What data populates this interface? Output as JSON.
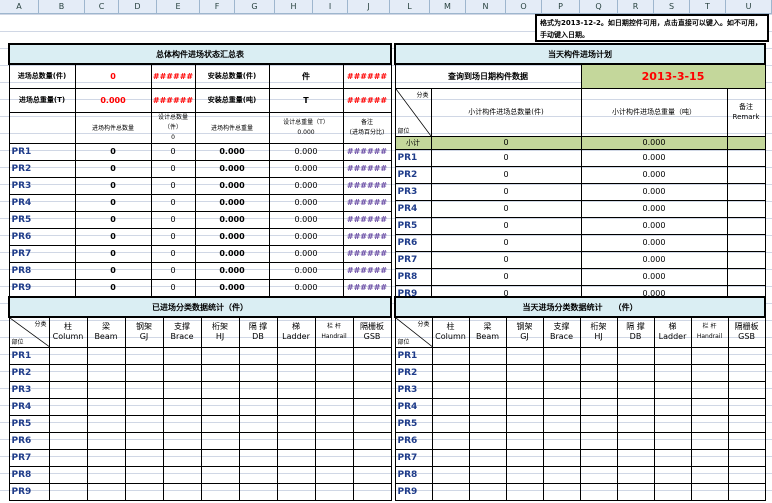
{
  "columns": [
    "A",
    "B",
    "C",
    "D",
    "E",
    "F",
    "G",
    "H",
    "I",
    "J",
    "L",
    "M",
    "N",
    "O",
    "P",
    "Q",
    "R",
    "S",
    "T",
    "U"
  ],
  "note": "格式为2013-12-2。如日期控件可用，点击直接可以键入。如不可用，手动键入日期。",
  "left_summary": {
    "title": "总体构件进场状态汇总表",
    "row1": {
      "label": "进场总数量(件)",
      "value": "0",
      "hash": "######",
      "label2": "安装总数量(件)",
      "unit": "件",
      "hash2": "######"
    },
    "row2": {
      "label": "进场总重量(T)",
      "value": "0.000",
      "hash": "######",
      "label2": "安装总重量(吨)",
      "unit": "T",
      "hash2": "######"
    },
    "header": {
      "col1": "进场构件总数量",
      "col2": "设计总数量（件）",
      "col2sub": "0",
      "col3": "进场构件总重量",
      "col4": "设计总重量（T）",
      "col4sub": "0.000",
      "col5": "备注",
      "col5sub": "(进场百分比)"
    },
    "rows": [
      {
        "name": "PR1",
        "count": "0",
        "design": "0",
        "weight": "0.000",
        "dweight": "0.000",
        "pct": "######"
      },
      {
        "name": "PR2",
        "count": "0",
        "design": "0",
        "weight": "0.000",
        "dweight": "0.000",
        "pct": "######"
      },
      {
        "name": "PR3",
        "count": "0",
        "design": "0",
        "weight": "0.000",
        "dweight": "0.000",
        "pct": "######"
      },
      {
        "name": "PR4",
        "count": "0",
        "design": "0",
        "weight": "0.000",
        "dweight": "0.000",
        "pct": "######"
      },
      {
        "name": "PR5",
        "count": "0",
        "design": "0",
        "weight": "0.000",
        "dweight": "0.000",
        "pct": "######"
      },
      {
        "name": "PR6",
        "count": "0",
        "design": "0",
        "weight": "0.000",
        "dweight": "0.000",
        "pct": "######"
      },
      {
        "name": "PR7",
        "count": "0",
        "design": "0",
        "weight": "0.000",
        "dweight": "0.000",
        "pct": "######"
      },
      {
        "name": "PR8",
        "count": "0",
        "design": "0",
        "weight": "0.000",
        "dweight": "0.000",
        "pct": "######"
      },
      {
        "name": "PR9",
        "count": "0",
        "design": "0",
        "weight": "0.000",
        "dweight": "0.000",
        "pct": "######"
      }
    ]
  },
  "right_summary": {
    "title": "当天构件进场计划",
    "query_label": "查询到场日期构件数据",
    "query_date": "2013-3-15",
    "diag_top": "分类",
    "diag_bottom": "部位",
    "col1": "小计构件进场总数量(件)",
    "col2": "小计构件进场总重量（吨）",
    "col3": "备注",
    "col3sub": "Remark",
    "subtotal": {
      "name": "小计",
      "count": "0",
      "weight": "0.000"
    },
    "rows": [
      {
        "name": "PR1",
        "count": "0",
        "weight": "0.000"
      },
      {
        "name": "PR2",
        "count": "0",
        "weight": "0.000"
      },
      {
        "name": "PR3",
        "count": "0",
        "weight": "0.000"
      },
      {
        "name": "PR4",
        "count": "0",
        "weight": "0.000"
      },
      {
        "name": "PR5",
        "count": "0",
        "weight": "0.000"
      },
      {
        "name": "PR6",
        "count": "0",
        "weight": "0.000"
      },
      {
        "name": "PR7",
        "count": "0",
        "weight": "0.000"
      },
      {
        "name": "PR8",
        "count": "0",
        "weight": "0.000"
      },
      {
        "name": "PR9",
        "count": "0",
        "weight": "0.000"
      }
    ]
  },
  "left_category": {
    "title": "已进场分类数据统计（件）",
    "diag_top": "分类",
    "diag_bottom": "部位",
    "headers": [
      {
        "cn": "柱",
        "en": "Column"
      },
      {
        "cn": "梁",
        "en": "Beam"
      },
      {
        "cn": "钢架",
        "en": "GJ"
      },
      {
        "cn": "支撑",
        "en": "Brace"
      },
      {
        "cn": "桁架",
        "en": "HJ"
      },
      {
        "cn": "隔 撑",
        "en": "DB"
      },
      {
        "cn": "梯",
        "en": "Ladder"
      },
      {
        "cn": "栏 杆",
        "en": "Handrail"
      },
      {
        "cn": "隔栅板",
        "en": "GSB"
      }
    ],
    "rows": [
      "PR1",
      "PR2",
      "PR3",
      "PR4",
      "PR5",
      "PR6",
      "PR7",
      "PR8",
      "PR9"
    ]
  },
  "right_category": {
    "title": "当天进场分类数据统计",
    "title_unit": "（件）",
    "diag_top": "分类",
    "diag_bottom": "部位",
    "headers": [
      {
        "cn": "柱",
        "en": "Column"
      },
      {
        "cn": "梁",
        "en": "Beam"
      },
      {
        "cn": "钢架",
        "en": "GJ"
      },
      {
        "cn": "支撑",
        "en": "Brace"
      },
      {
        "cn": "桁架",
        "en": "HJ"
      },
      {
        "cn": "隔 撑",
        "en": "DB"
      },
      {
        "cn": "梯",
        "en": "Ladder"
      },
      {
        "cn": "栏 杆",
        "en": "Handrail"
      },
      {
        "cn": "隔栅板",
        "en": "GSB"
      }
    ],
    "rows": [
      "PR1",
      "PR2",
      "PR3",
      "PR4",
      "PR5",
      "PR6",
      "PR7",
      "PR8",
      "PR9"
    ]
  }
}
